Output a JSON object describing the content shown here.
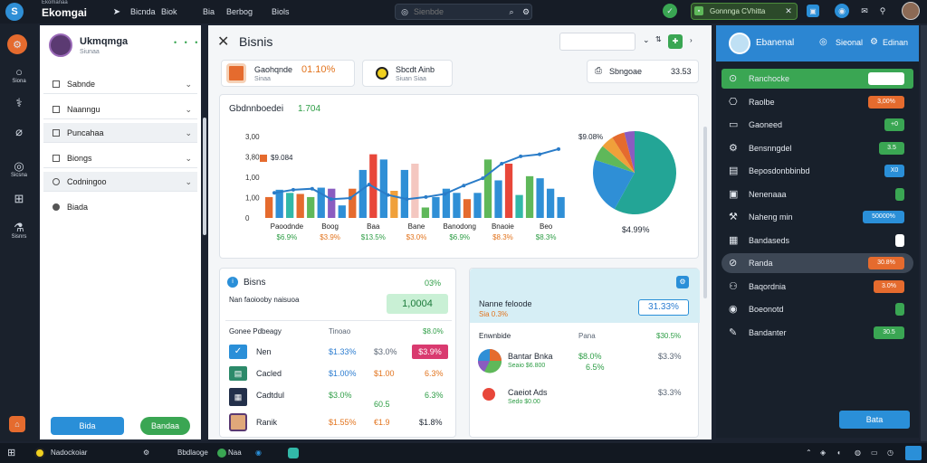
{
  "topbar": {
    "app_sub": "Ekomanaa",
    "app_name": "Ekomgai",
    "nav": [
      "Bicnda",
      "Biok",
      "Bia",
      "Berbog",
      "Biols"
    ],
    "search_placeholder": "Sienbde",
    "status_pill": "Gonnnga CVhitta",
    "logo_glyph": "S"
  },
  "rail": {
    "items": [
      {
        "label": "Siona",
        "icon": "home-icon"
      },
      {
        "label": "",
        "icon": "chart-icon"
      },
      {
        "label": "",
        "icon": "globe-icon"
      },
      {
        "label": "Sicsna",
        "icon": "camera-icon"
      },
      {
        "label": "",
        "icon": "grid-icon"
      },
      {
        "label": "Sisnrs",
        "icon": "flask-icon"
      }
    ]
  },
  "sidepanel": {
    "profile_name": "Ukmqmga",
    "profile_sub": "Siunaa",
    "menu": [
      "Sabnde",
      "Naanngu",
      "Puncahaa",
      "Biongs",
      "Codningoo",
      "Biada"
    ],
    "btn_primary": "Bida",
    "btn_secondary": "Bandaa"
  },
  "header": {
    "title": "Bisnis"
  },
  "stats": {
    "s1_label": "Gaohqnde",
    "s1_value": "01.10%",
    "s1_sub": "Sinaa",
    "s2_label": "Sbcdt Ainb",
    "s2_sub": "Siuan Siaa",
    "s3_label": "Sbngoae",
    "s3_value": "33.53"
  },
  "chart_card": {
    "title": "Gbdnnboedei",
    "title_value": "1.704",
    "legend_value": "$9.084",
    "pie_label": "$9.08%",
    "pie_value": "$4.99%"
  },
  "chart_data": {
    "type": "bar",
    "y_ticks": [
      "3,00",
      "3,80",
      "1,00",
      "1,00",
      "0"
    ],
    "ylim": [
      0,
      3.9
    ],
    "categories": [
      "Paoodnde",
      "Boog",
      "Baa",
      "Bane",
      "Banodong",
      "Bnaoie",
      "Beo"
    ],
    "category_values": [
      "$6.9%",
      "$3.9%",
      "$13.5%",
      "$3.0%",
      "$6.9%",
      "$8.3%",
      "$8.3%"
    ],
    "bars": [
      {
        "value": 1.0,
        "color": "#e56b2e"
      },
      {
        "value": 1.35,
        "color": "#2f8fd6"
      },
      {
        "value": 1.2,
        "color": "#32b8a8"
      },
      {
        "value": 1.15,
        "color": "#e56b2e"
      },
      {
        "value": 1.0,
        "color": "#5fb85a"
      },
      {
        "value": 1.45,
        "color": "#2f8fd6"
      },
      {
        "value": 1.4,
        "color": "#8a5cc0"
      },
      {
        "value": 0.6,
        "color": "#2f8fd6"
      },
      {
        "value": 1.4,
        "color": "#e56b2e"
      },
      {
        "value": 2.3,
        "color": "#2f8fd6"
      },
      {
        "value": 3.05,
        "color": "#e8473a"
      },
      {
        "value": 2.8,
        "color": "#2f8fd6"
      },
      {
        "value": 1.3,
        "color": "#f0a03a"
      },
      {
        "value": 2.3,
        "color": "#2f8fd6"
      },
      {
        "value": 2.6,
        "color": "#f4c7c0"
      },
      {
        "value": 0.5,
        "color": "#5fb85a"
      },
      {
        "value": 1.0,
        "color": "#2f8fd6"
      },
      {
        "value": 1.4,
        "color": "#2f8fd6"
      },
      {
        "value": 1.2,
        "color": "#2f8fd6"
      },
      {
        "value": 0.9,
        "color": "#e56b2e"
      },
      {
        "value": 1.2,
        "color": "#2f8fd6"
      },
      {
        "value": 2.8,
        "color": "#5fb85a"
      },
      {
        "value": 1.8,
        "color": "#2f8fd6"
      },
      {
        "value": 2.6,
        "color": "#e8473a"
      },
      {
        "value": 1.1,
        "color": "#32b8a8"
      },
      {
        "value": 2.0,
        "color": "#5fb85a"
      },
      {
        "value": 1.9,
        "color": "#2f8fd6"
      },
      {
        "value": 1.4,
        "color": "#2f8fd6"
      },
      {
        "value": 1.0,
        "color": "#2f8fd6"
      }
    ],
    "line": [
      1.2,
      1.35,
      1.4,
      0.9,
      0.95,
      1.6,
      1.1,
      0.9,
      1.0,
      1.15,
      1.55,
      1.9,
      2.6,
      2.95,
      3.05,
      3.3
    ],
    "pie": [
      {
        "value": 0.58,
        "color": "#23a596"
      },
      {
        "value": 0.22,
        "color": "#2f8fd6"
      },
      {
        "value": 0.06,
        "color": "#5fb85a"
      },
      {
        "value": 0.05,
        "color": "#f0a03a"
      },
      {
        "value": 0.05,
        "color": "#e56b2e"
      },
      {
        "value": 0.04,
        "color": "#8a5cc0"
      }
    ]
  },
  "table_card": {
    "title": "Bisns",
    "title_value": "03%",
    "subtitle": "Nan faoiooby naisuoa",
    "big_value": "1,0004",
    "col_name": "Gonee Pdbeagy",
    "col_value": "Tinoao",
    "col_pct": "$8.0%",
    "rows": [
      {
        "name": "Nen",
        "v1": "$1.33%",
        "v2": "$3.0%",
        "v3": "$3.9%",
        "icon": "check-icon"
      },
      {
        "name": "Cacled",
        "v1": "$1.00%",
        "v2": "$1.00",
        "v3": "6.3%",
        "icon": "document-icon"
      },
      {
        "name": "Cadtdul",
        "v1": "$3.0%",
        "v2": "60.5",
        "v3": "6.3%",
        "icon": "building-icon"
      },
      {
        "name": "Ranik",
        "v1": "$1.55%",
        "v2": "€1.9",
        "v3": "$1.8%",
        "icon": "user-icon"
      }
    ]
  },
  "info_card": {
    "title": "Nanne feloode",
    "title_sub": "Sia 0.3%",
    "value": "31.33%",
    "col_a": "Enwnbide",
    "col_b": "Pana",
    "col_c": "$30.5%",
    "rows": [
      {
        "name": "Bantar Bnka",
        "sub": "Seaio $6.800",
        "v1": "$8.0%",
        "v2": "$3.3%",
        "v3": "6.5%"
      },
      {
        "name": "Caeiot Ads",
        "sub": "Sedo $0.00",
        "v1": "",
        "v2": "$3.3%",
        "v3": ""
      }
    ]
  },
  "right_panel": {
    "header_a": "Ebanenal",
    "header_b": "Sieonal",
    "header_c": "Edinan",
    "rows": [
      {
        "label": "Ranchocke",
        "badge": "",
        "badge_color": "#ffffff",
        "active": true
      },
      {
        "label": "Raolbe",
        "badge": "3,00%",
        "badge_color": "#e56b2e",
        "active": false
      },
      {
        "label": "Gaoneed",
        "badge": "+0",
        "badge_color": "#3aa653",
        "active": false
      },
      {
        "label": "Bensnngdel",
        "badge": "3.5",
        "badge_color": "#3aa653",
        "active": false
      },
      {
        "label": "Beposdonbbinbd",
        "badge": "X0",
        "badge_color": "#2a8fd8",
        "active": false
      },
      {
        "label": "Nenenaaa",
        "badge": "",
        "badge_color": "#3aa653",
        "active": false
      },
      {
        "label": "Naheng min",
        "badge": "50000%",
        "badge_color": "#2a8fd8",
        "active": false
      },
      {
        "label": "Bandaseds",
        "badge": "",
        "badge_color": "#ffffff",
        "active": false
      },
      {
        "label": "Randa",
        "badge": "30.8%",
        "badge_color": "#e56b2e",
        "active": false
      },
      {
        "label": "Baqordnia",
        "badge": "3.0%",
        "badge_color": "#e56b2e",
        "active": false
      },
      {
        "label": "Boeonotd",
        "badge": "",
        "badge_color": "#3aa653",
        "active": false
      },
      {
        "label": "Bandanter",
        "badge": "30.5",
        "badge_color": "#3aa653",
        "active": false
      }
    ],
    "button": "Bata"
  },
  "taskbar": {
    "items": [
      "Nadockoiar",
      "Bbdlaoge",
      "Naa"
    ]
  }
}
